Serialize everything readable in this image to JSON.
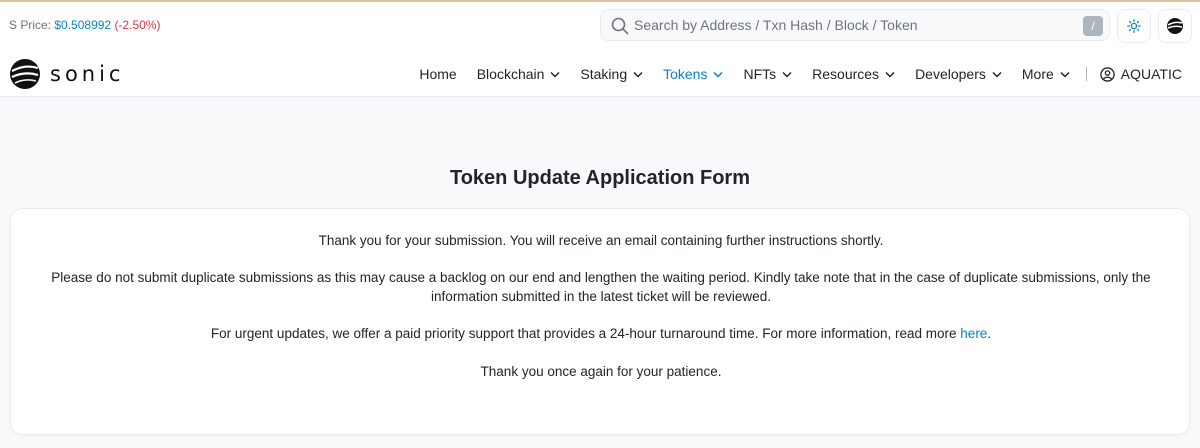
{
  "header": {
    "price_label": "S Price: ",
    "price_value": "$0.508992",
    "price_change": "(-2.50%)",
    "search_placeholder": "Search by Address / Txn Hash / Block / Token",
    "search_shortcut": "/"
  },
  "brand": {
    "name": "sonic"
  },
  "nav": {
    "home": "Home",
    "blockchain": "Blockchain",
    "staking": "Staking",
    "tokens": "Tokens",
    "nfts": "NFTs",
    "resources": "Resources",
    "developers": "Developers",
    "more": "More",
    "user": "AQUATIC"
  },
  "main": {
    "title": "Token Update Application Form",
    "p1": "Thank you for your submission. You will receive an email containing further instructions shortly.",
    "p2": "Please do not submit duplicate submissions as this may cause a backlog on our end and lengthen the waiting period. Kindly take note that in the case of duplicate submissions, only the information submitted in the latest ticket will be reviewed.",
    "p3_text": "For urgent updates, we offer a paid priority support that provides a 24-hour turnaround time. For more information, read more ",
    "p3_link": "here",
    "p3_end": ".",
    "p4": "Thank you once again for your patience."
  },
  "colors": {
    "link": "#0784c3",
    "negative": "#dc3545",
    "accent_line": "#e3c2a4"
  }
}
